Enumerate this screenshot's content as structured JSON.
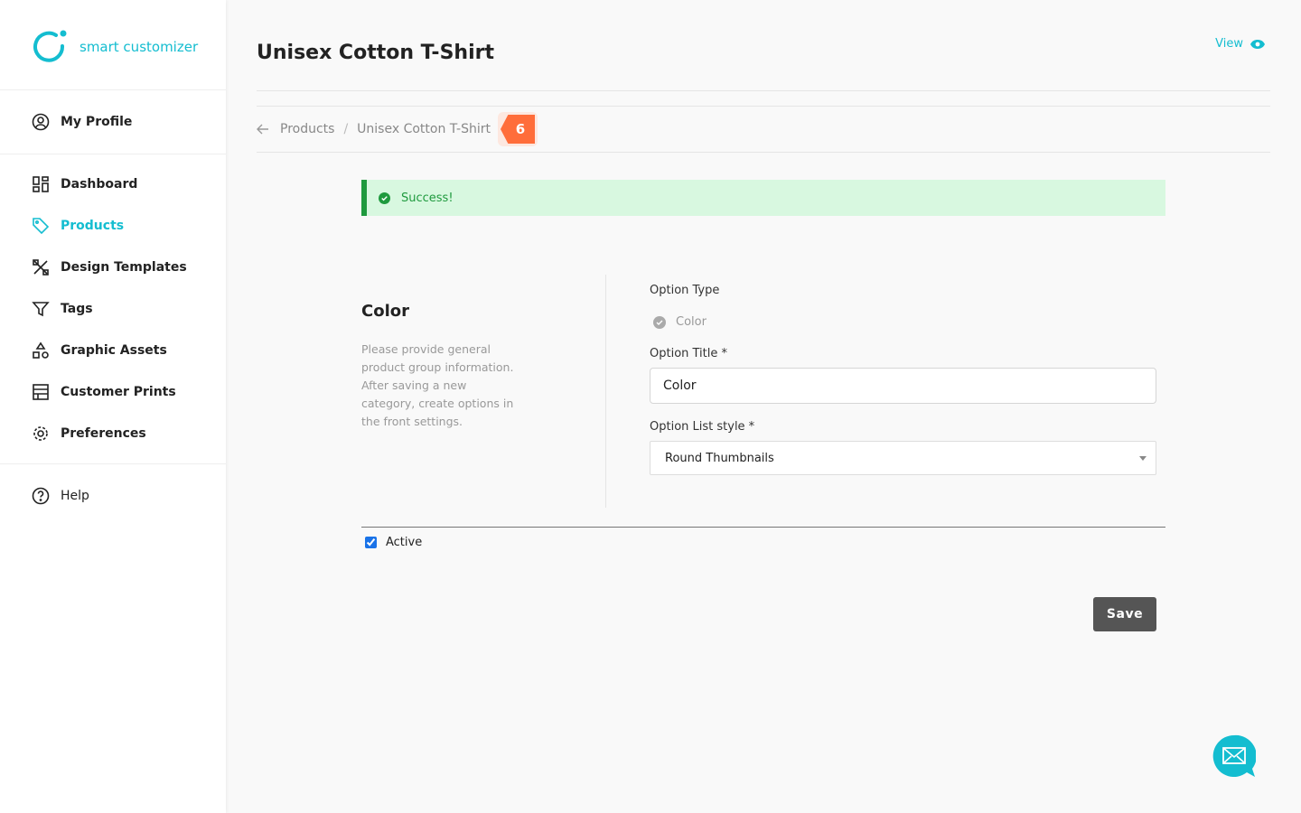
{
  "brand": {
    "name": "smart customizer",
    "color": "#14bdd0"
  },
  "sidebar": {
    "profile": "My Profile",
    "items": [
      {
        "label": "Dashboard",
        "icon": "dashboard-icon"
      },
      {
        "label": "Products",
        "icon": "tag-icon",
        "active": true
      },
      {
        "label": "Design Templates",
        "icon": "design-tools-icon"
      },
      {
        "label": "Tags",
        "icon": "filter-icon"
      },
      {
        "label": "Graphic Assets",
        "icon": "shapes-icon"
      },
      {
        "label": "Customer Prints",
        "icon": "prints-icon"
      },
      {
        "label": "Preferences",
        "icon": "gear-icon"
      }
    ],
    "help": "Help"
  },
  "header": {
    "title": "Unisex Cotton T-Shirt",
    "view": "View"
  },
  "breadcrumb": {
    "items": [
      "Products",
      "Unisex Cotton T-Shirt"
    ],
    "badge": "6",
    "badge_color": "#ff6d3a"
  },
  "alert": {
    "text": "Success!",
    "color": "#1f9a3e"
  },
  "section": {
    "title": "Color",
    "description": "Please provide general product group information. After saving a new category, create options in the front settings."
  },
  "form": {
    "option_type_label": "Option Type",
    "option_type_value": "Color",
    "option_title_label": "Option Title *",
    "option_title_value": "Color",
    "list_style_label": "Option List style *",
    "list_style_value": "Round Thumbnails",
    "active_label": "Active",
    "active_checked": true,
    "save": "Save"
  }
}
